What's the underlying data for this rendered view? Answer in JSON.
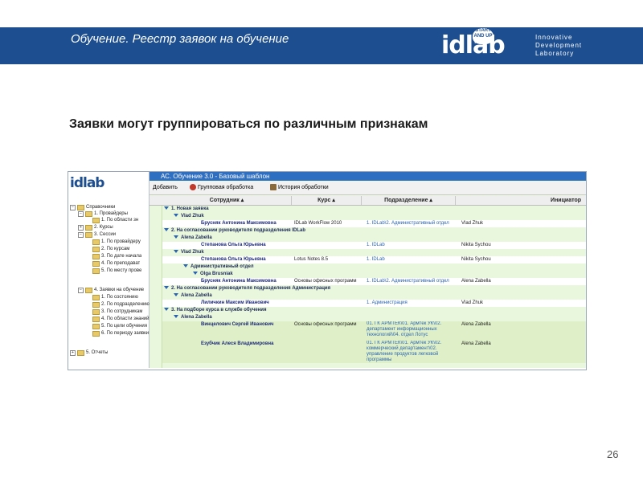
{
  "header": {
    "title": "Обучение. Реестр заявок на обучение",
    "logo_text": "idlab",
    "logo_badge": "START AND UP",
    "logo_tagline": [
      "Innovative",
      "Development",
      "Laboratory"
    ]
  },
  "heading": "Заявки могут группироваться по различным признакам",
  "page_number": "26",
  "app": {
    "left_logo": "idlab",
    "window_title": "АС. Обучение 3.0 - Базовый шаблон",
    "toolbar": {
      "add": "Добавить",
      "group": "Групповая обработка",
      "history": "История обработки"
    },
    "columns": [
      "Сотрудник",
      "Курс",
      "Подразделение",
      "Инициатор"
    ],
    "tree": [
      {
        "label": "Справочники",
        "pm": "−"
      },
      {
        "label": "1. Провайдеры",
        "pm": "−"
      },
      {
        "label": "1. По области зн",
        "pm": ""
      },
      {
        "label": "2. Курсы",
        "pm": "+"
      },
      {
        "label": "3. Сессии",
        "pm": "−"
      },
      {
        "label": "1. По провайдеру",
        "pm": ""
      },
      {
        "label": "2. По курсам",
        "pm": ""
      },
      {
        "label": "3. По дате начала",
        "pm": ""
      },
      {
        "label": "4. По преподават",
        "pm": ""
      },
      {
        "label": "5. По месту прове",
        "pm": ""
      },
      {
        "label": "4. Заявки на обучение",
        "pm": "−"
      },
      {
        "label": "1. По состоянию",
        "pm": ""
      },
      {
        "label": "2. По подразделению",
        "pm": ""
      },
      {
        "label": "3. По сотрудникам",
        "pm": ""
      },
      {
        "label": "4. По области знаний",
        "pm": ""
      },
      {
        "label": "5. По цели обучения",
        "pm": ""
      },
      {
        "label": "6. По периоду заявки",
        "pm": ""
      },
      {
        "label": "5. Отчеты",
        "pm": "+"
      }
    ],
    "rows": [
      {
        "kind": "grp",
        "text": "1. Новая заявка"
      },
      {
        "kind": "grp",
        "text": "Vlad Zhuk"
      },
      {
        "kind": "data",
        "emp": "Брусняк Антонина Максимовна",
        "crs": "IDLab WorkFlow 2010",
        "dep": "1. IDLab\\2. Административный отдел",
        "ini": "Vlad Zhuk"
      },
      {
        "kind": "grp",
        "text": "2. На согласовании руководителя подразделения IDLab"
      },
      {
        "kind": "grp",
        "text": "Alena Zabella"
      },
      {
        "kind": "data",
        "emp": "Степанова Ольга Юрьевна",
        "crs": "",
        "dep": "1. IDLab",
        "ini": "Nikita Sychou"
      },
      {
        "kind": "grp",
        "text": "Vlad Zhuk"
      },
      {
        "kind": "data",
        "emp": "Степанова Ольга Юрьевна",
        "crs": "Lotus Notes 8.5",
        "dep": "1. IDLab",
        "ini": "Nikita Sychou"
      },
      {
        "kind": "grp",
        "text": "Административный отдел"
      },
      {
        "kind": "grp",
        "text": "Olga Brusniak"
      },
      {
        "kind": "data",
        "emp": "Брусняк Антонина Максимовна",
        "crs": "Основы офисных программ",
        "dep": "1. IDLab\\2. Административный отдел",
        "ini": "Alena Zabella"
      },
      {
        "kind": "grp",
        "text": "2. На согласовании руководителя подразделения Администрация"
      },
      {
        "kind": "grp",
        "text": "Alena Zabella"
      },
      {
        "kind": "data",
        "emp": "Лиличкин Максим Иванович",
        "crs": "",
        "dep": "1. Администрация",
        "ini": "Vlad Zhuk"
      },
      {
        "kind": "grp",
        "text": "3. На подборе курса в службе обучения"
      },
      {
        "kind": "grp",
        "text": "Alena Zabella"
      },
      {
        "kind": "data2",
        "emp": "Винцелович Сергей Иванович",
        "crs": "Основы офисных программ",
        "dep": "01. ГК АРМТЕК\\01. Армтек УК\\02. департамент информационных технологий\\04. отдел Лотус",
        "ini": "Alena Zabella"
      },
      {
        "kind": "data3",
        "emp": "Езубчик Алеся Владимировна",
        "crs": "",
        "dep": "01. ГК АРМТЕК\\01. Армтек УК\\02. коммерческий департамент\\02. управление продуктов легковой программы",
        "ini": "Alena Zabella"
      }
    ]
  },
  "colors": {
    "topbar": "#1d4e8f",
    "titlebar": "#2f6fc2",
    "grid_bg": "#e9f7dc"
  }
}
